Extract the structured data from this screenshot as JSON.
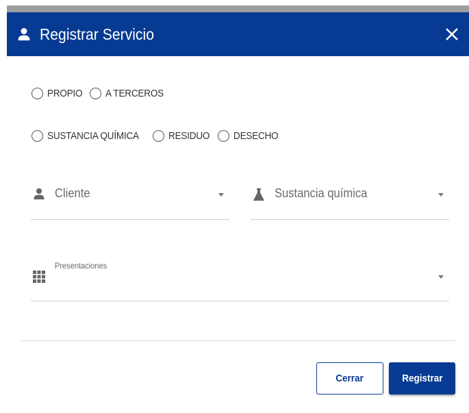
{
  "dialog": {
    "title": "Registrar Servicio",
    "close_icon": "close-icon",
    "header_icon": "person-icon",
    "header_color": "#073b93"
  },
  "owner_options": [
    "PROPIO",
    "A TERCEROS"
  ],
  "type_options": [
    "SUSTANCIA QUÍMICA",
    "RESIDUO",
    "DESECHO"
  ],
  "fields": {
    "cliente": {
      "placeholder": "Cliente",
      "icon": "person-icon"
    },
    "sustancia": {
      "placeholder": "Sustancia química",
      "icon": "flask-icon"
    },
    "presentaciones": {
      "label": "Presentaciones",
      "icon": "grid-icon"
    }
  },
  "buttons": {
    "cerrar": "Cerrar",
    "registrar": "Registrar"
  }
}
